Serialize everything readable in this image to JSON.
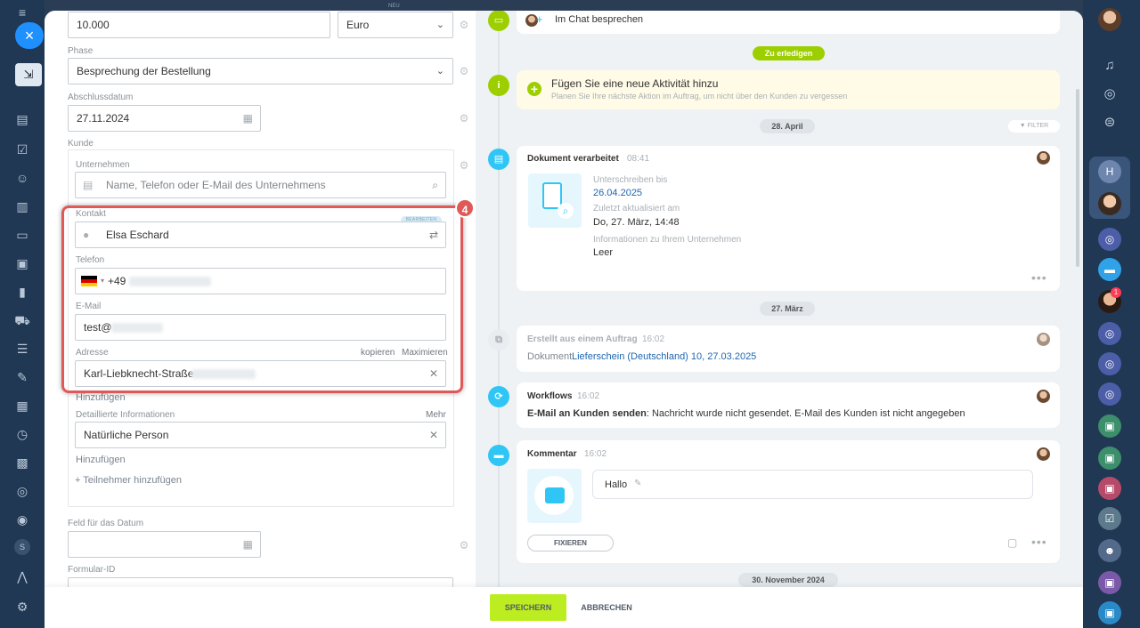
{
  "form": {
    "amount_value": "10.000",
    "currency_value": "Euro",
    "phase_label": "Phase",
    "phase_value": "Besprechung der Bestellung",
    "close_date_label": "Abschlussdatum",
    "close_date_value": "27.11.2024",
    "client_label": "Kunde",
    "company_label": "Unternehmen",
    "company_placeholder": "Name, Telefon oder E-Mail des Unternehmens",
    "contact_label": "Kontakt",
    "edit_chip": "BEARBEITEN",
    "contact_value": "Elsa Eschard",
    "phone_label": "Telefon",
    "phone_prefix": "+49",
    "email_label": "E-Mail",
    "email_value": "test@",
    "address_label": "Adresse",
    "copy_label": "kopieren",
    "maximize_label": "Maximieren",
    "address_value": "Karl-Liebknecht-Straße",
    "add_label_1": "Hinzufügen",
    "details_label": "Detaillierte Informationen",
    "more_label": "Mehr",
    "details_value": "Natürliche Person",
    "add_label_2": "Hinzufügen",
    "add_participant": "+ Teilnehmer hinzufügen",
    "date_field_label": "Feld für das Datum",
    "form_id_label": "Formular-ID",
    "highlight_number": "4"
  },
  "timeline": {
    "chat_label": "Im Chat besprechen",
    "todo_pill": "Zu erledigen",
    "new_activity_title": "Fügen Sie eine neue Aktivität hinzu",
    "new_activity_sub": "Planen Sie Ihre nächste Aktion im Auftrag, um nicht über den Kunden zu vergessen",
    "date_1": "28. April",
    "filter_label": "FILTER",
    "doc_title": "Dokument verarbeitet",
    "doc_time": "08:41",
    "sign_until_label": "Unterschreiben bis",
    "sign_until_value": "26.04.2025",
    "updated_label": "Zuletzt aktualisiert am",
    "updated_value": "Do, 27. März, 14:48",
    "company_info_label": "Informationen zu Ihrem Unternehmen",
    "company_info_value": "Leer",
    "date_2": "27. März",
    "created_title": "Erstellt aus einem Auftrag",
    "created_time": "16:02",
    "created_doc_prefix": "Dokument",
    "created_doc_link": "Lieferschein (Deutschland) 10, 27.03.2025",
    "workflows_title": "Workflows",
    "workflows_time": "16:02",
    "workflows_bold": "E-Mail an Kunden senden",
    "workflows_text": ": Nachricht wurde nicht gesendet. E-Mail des Kunden ist nicht angegeben",
    "comment_title": "Kommentar",
    "comment_time": "16:02",
    "comment_text": "Hallo",
    "pin_button": "FIXIEREN",
    "date_3": "30. November 2024"
  },
  "footer": {
    "save_label": "SPEICHERN",
    "cancel_label": "ABBRECHEN"
  },
  "rails": {
    "left_close": "×",
    "neu_label": "NEU",
    "left_s": "S",
    "right_badge": "1"
  },
  "colors": {
    "accent_green": "#9dcf00",
    "save_green": "#bbed21",
    "link_blue": "#2067b0",
    "highlight_red": "#e05959",
    "timeline_blue": "#2fc6f6"
  }
}
